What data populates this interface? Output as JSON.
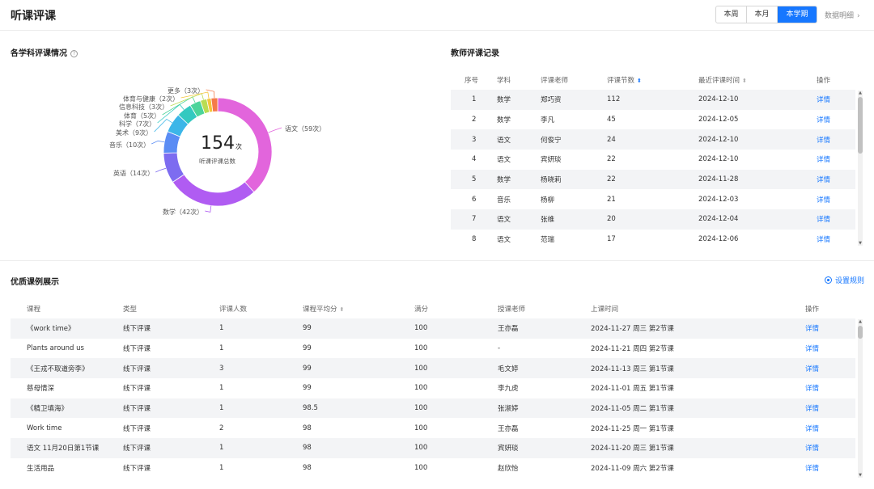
{
  "header": {
    "title": "听课评课",
    "periods": [
      {
        "label": "本周",
        "active": false
      },
      {
        "label": "本月",
        "active": false
      },
      {
        "label": "本学期",
        "active": true
      }
    ],
    "data_link": "数据明细"
  },
  "subject_panel": {
    "title": "各学科评课情况",
    "center_value": "154",
    "center_unit": "次",
    "center_label": "听课评课总数",
    "colors": {
      "语文": "#e265dc",
      "数学": "#b05cf2",
      "英语": "#7d6cf0",
      "音乐": "#5a8cf4",
      "美术": "#3cb6e8",
      "科学": "#33c9c0",
      "体育": "#4cd49a",
      "信息科技": "#b9dc52",
      "体育与健康": "#f5c53b",
      "更多": "#f57a4a"
    }
  },
  "chart_data": {
    "type": "pie",
    "variant": "donut",
    "title": "各学科评课情况",
    "total": 154,
    "categories": [
      "语文",
      "数学",
      "英语",
      "音乐",
      "美术",
      "科学",
      "体育",
      "信息科技",
      "体育与健康",
      "更多"
    ],
    "values": [
      59,
      42,
      14,
      10,
      9,
      7,
      5,
      3,
      2,
      3
    ],
    "labels": [
      "语文（59次）",
      "数学（42次）",
      "英语（14次）",
      "音乐（10次）",
      "美术（9次）",
      "科学（7次）",
      "体育（5次）",
      "信息科技（3次）",
      "体育与健康（2次）",
      "更多（3次）"
    ]
  },
  "teacher_panel": {
    "title": "教师评课记录",
    "columns": [
      "序号",
      "学科",
      "评课老师",
      "评课节数",
      "最近评课时间",
      "操作"
    ],
    "rows": [
      [
        "1",
        "数学",
        "郑巧资",
        "112",
        "2024-12-10",
        "详情"
      ],
      [
        "2",
        "数学",
        "李凡",
        "45",
        "2024-12-05",
        "详情"
      ],
      [
        "3",
        "语文",
        "何俊宁",
        "24",
        "2024-12-10",
        "详情"
      ],
      [
        "4",
        "语文",
        "宾妍琰",
        "22",
        "2024-12-10",
        "详情"
      ],
      [
        "5",
        "数学",
        "杨晓莉",
        "22",
        "2024-11-28",
        "详情"
      ],
      [
        "6",
        "音乐",
        "杨柳",
        "21",
        "2024-12-03",
        "详情"
      ],
      [
        "7",
        "语文",
        "张维",
        "20",
        "2024-12-04",
        "详情"
      ],
      [
        "8",
        "语文",
        "范瑞",
        "17",
        "2024-12-06",
        "详情"
      ]
    ]
  },
  "courses_panel": {
    "title": "优质课例展示",
    "rule_link": "设置规则",
    "columns": [
      "课程",
      "类型",
      "评课人数",
      "课程平均分",
      "满分",
      "授课老师",
      "上课时间",
      "操作"
    ],
    "rows": [
      [
        "《work time》",
        "线下评课",
        "1",
        "99",
        "100",
        "王亦磊",
        "2024-11-27 周三 第2节课",
        "详情"
      ],
      [
        "Plants around us",
        "线下评课",
        "1",
        "99",
        "100",
        "-",
        "2024-11-21 周四 第2节课",
        "详情"
      ],
      [
        "《王戎不取道旁李》",
        "线下评课",
        "3",
        "99",
        "100",
        "毛文婷",
        "2024-11-13 周三 第1节课",
        "详情"
      ],
      [
        "慈母情深",
        "线下评课",
        "1",
        "99",
        "100",
        "李九虎",
        "2024-11-01 周五 第1节课",
        "详情"
      ],
      [
        "《精卫填海》",
        "线下评课",
        "1",
        "98.5",
        "100",
        "张淑婷",
        "2024-11-05 周二 第1节课",
        "详情"
      ],
      [
        "Work time",
        "线下评课",
        "2",
        "98",
        "100",
        "王亦磊",
        "2024-11-25 周一 第1节课",
        "详情"
      ],
      [
        "语文 11月20日第1节课",
        "线下评课",
        "1",
        "98",
        "100",
        "宾妍琰",
        "2024-11-20 周三 第1节课",
        "详情"
      ],
      [
        "生活用品",
        "线下评课",
        "1",
        "98",
        "100",
        "赵欣怡",
        "2024-11-09 周六 第2节课",
        "详情"
      ]
    ]
  }
}
